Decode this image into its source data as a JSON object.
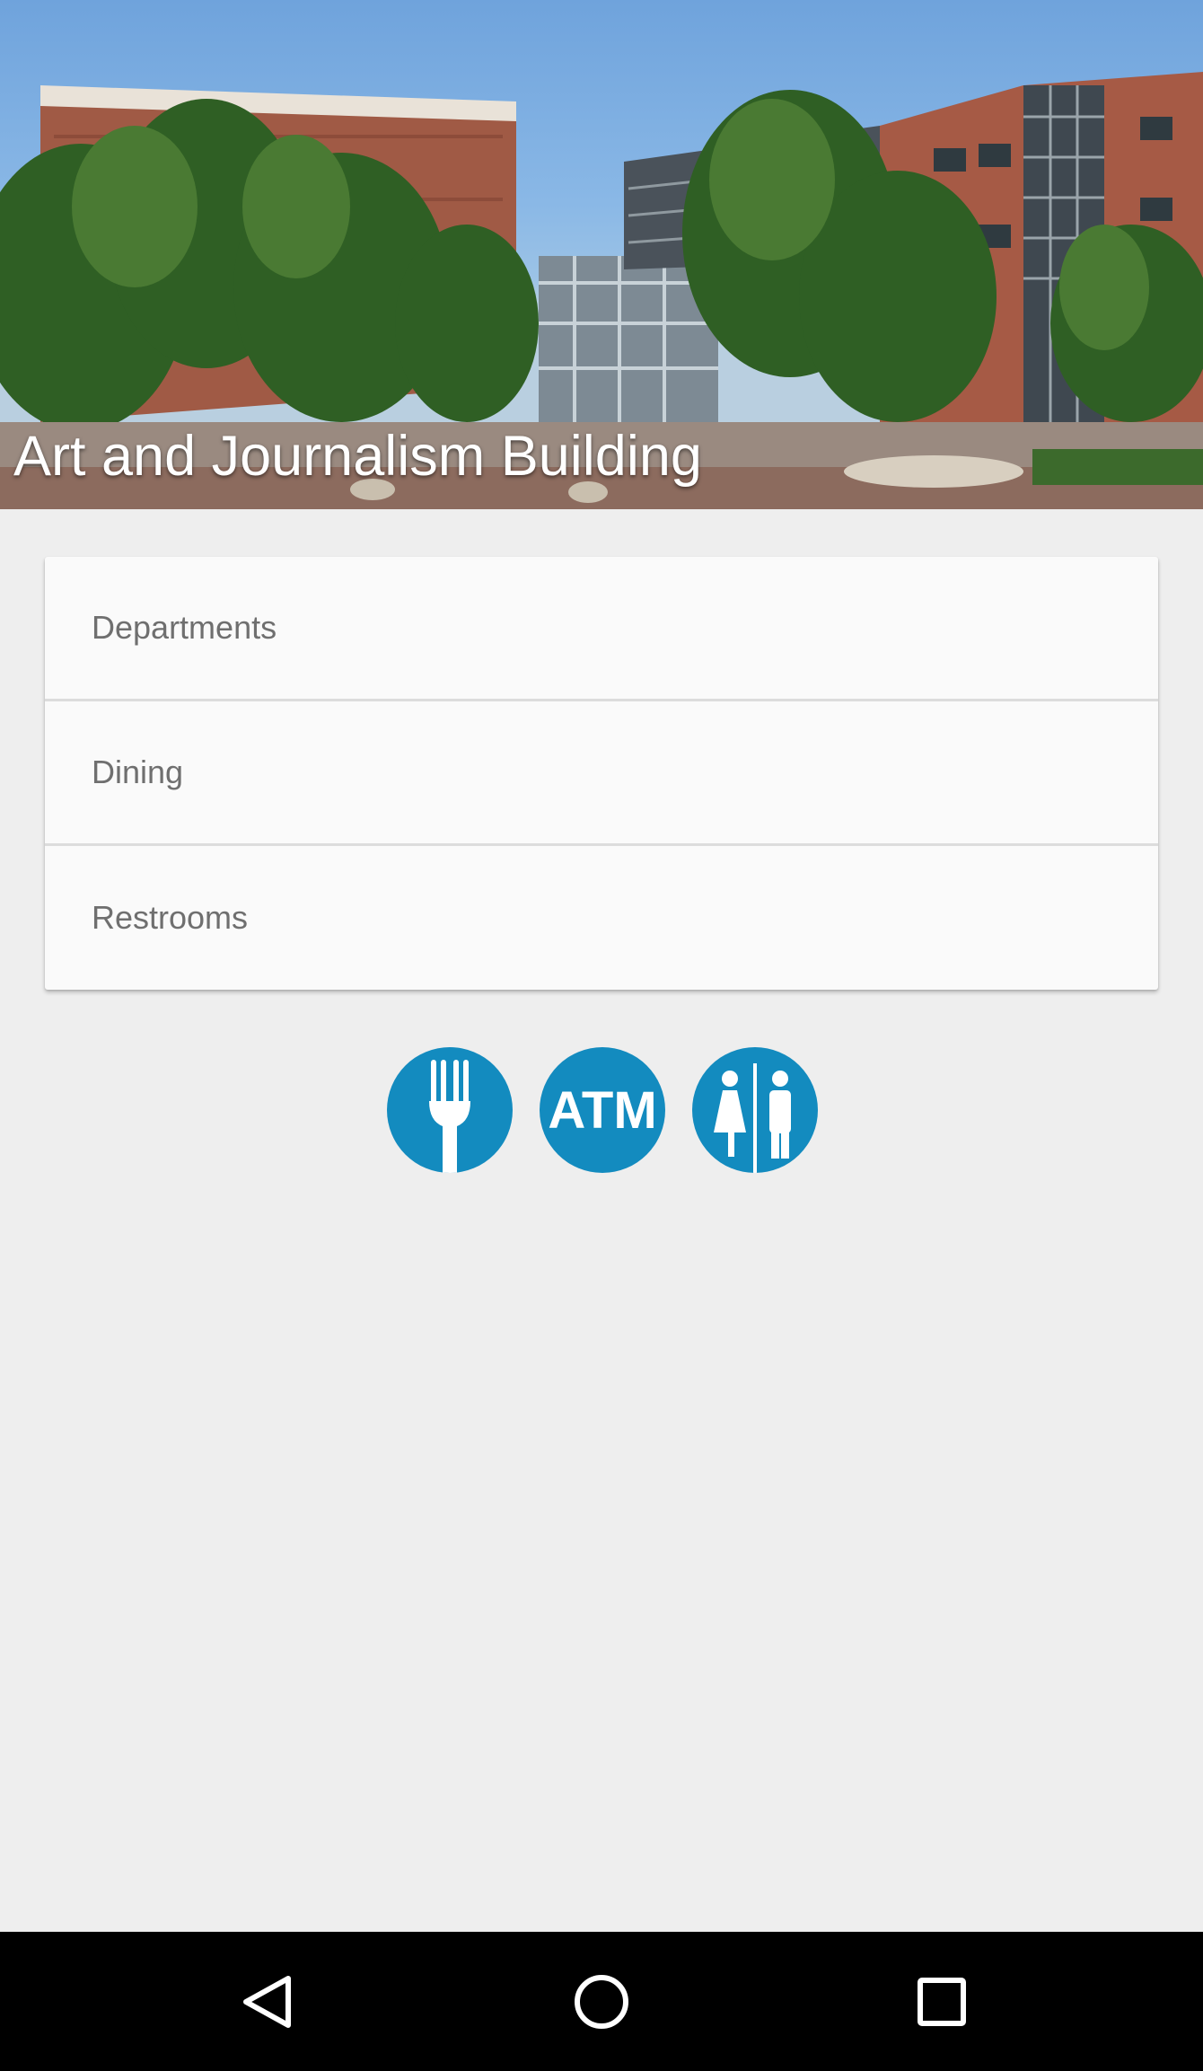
{
  "header": {
    "title": "Art and Journalism Building"
  },
  "menu": {
    "items": [
      {
        "label": "Departments"
      },
      {
        "label": "Dining"
      },
      {
        "label": "Restrooms"
      }
    ]
  },
  "amenities": {
    "dining_icon": "fork-icon",
    "atm_label": "ATM",
    "restroom_icon": "restroom-icon",
    "accent_color": "#138bbf"
  },
  "navbar": {
    "back_icon": "back-triangle-icon",
    "home_icon": "home-circle-icon",
    "recents_icon": "recents-square-icon"
  }
}
